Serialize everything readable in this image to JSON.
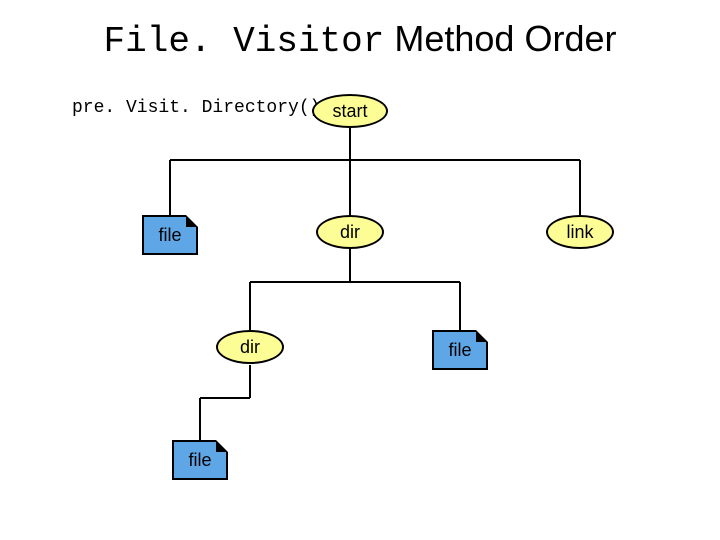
{
  "title": {
    "code_part": "File. Visitor",
    "rest_part": " Method Order"
  },
  "caption": "pre. Visit. Directory()",
  "nodes": {
    "start": "start",
    "dir_mid": "dir",
    "link": "link",
    "file_left": "file",
    "dir_lower": "dir",
    "file_right": "file",
    "file_bottom": "file"
  }
}
